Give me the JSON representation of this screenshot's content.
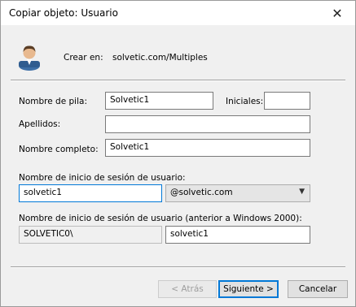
{
  "window": {
    "title": "Copiar objeto: Usuario",
    "close_glyph": "✕"
  },
  "header": {
    "icon": "user-icon",
    "create_label": "Crear en:",
    "create_value": "solvetic.com/Multiples"
  },
  "form": {
    "first_name_label": "Nombre de pila:",
    "first_name_value": "Solvetic1",
    "initials_label": "Iniciales:",
    "initials_value": "",
    "last_name_label": "Apellidos:",
    "last_name_value": "",
    "full_name_label": "Nombre completo:",
    "full_name_value": "Solvetic1",
    "logon_label": "Nombre de inicio de sesión de usuario:",
    "logon_value": "solvetic1",
    "domain_value": "@solvetic.com",
    "pre2000_label": "Nombre de inicio de sesión de usuario (anterior a Windows 2000):",
    "pre2000_domain": "SOLVETIC0\\",
    "pre2000_value": "solvetic1"
  },
  "buttons": {
    "back": "< Atrás",
    "next": "Siguiente >",
    "cancel": "Cancelar"
  }
}
